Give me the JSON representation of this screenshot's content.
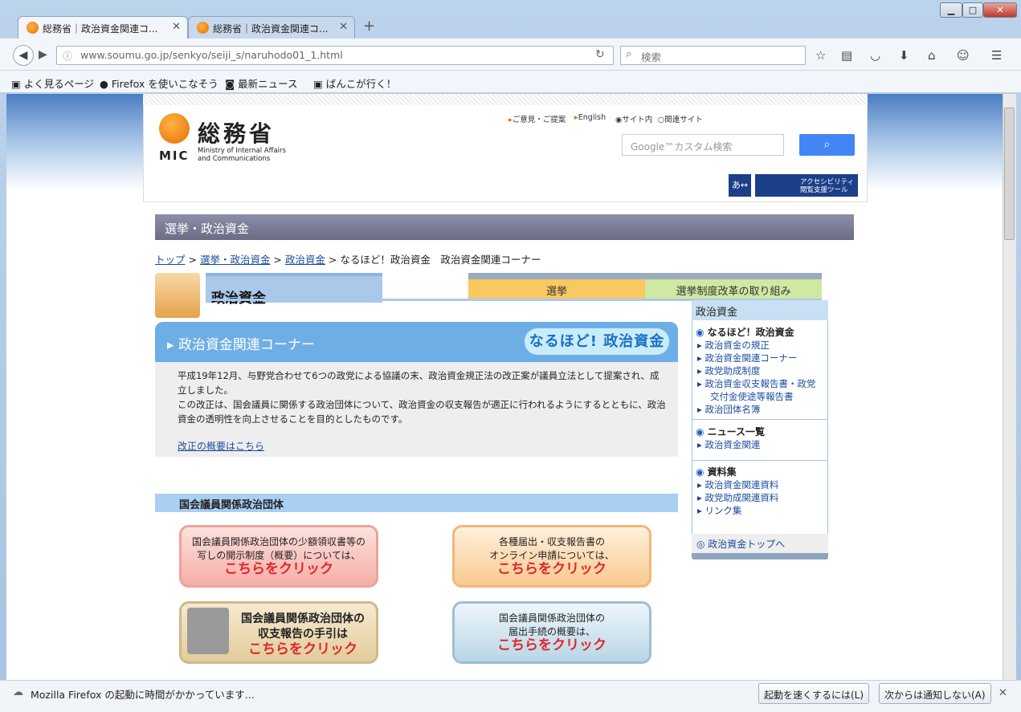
{
  "browser": {
    "tabs": [
      {
        "title": "総務省｜政治資金関連コ..."
      },
      {
        "title": "総務省｜政治資金関連コ..."
      }
    ],
    "url": "www.soumu.go.jp/senkyo/seiji_s/naruhodo01_1.html",
    "search_placeholder": "検索",
    "bookmarks": [
      "よく見るページ",
      "Firefox を使いこなそう",
      "最新ニュース",
      "ばんこが行く！"
    ],
    "status_message": "Mozilla Firefox の起動に時間がかかっています...",
    "status_buttons": [
      "起動を速くするには(L)",
      "次からは通知しない(A)"
    ]
  },
  "site": {
    "logo_text": "総務省",
    "logo_mic": "MIC",
    "logo_sub1": "Ministry of Internal Affairs",
    "logo_sub2": "and Communications",
    "links": [
      "ご意見・ご提案",
      "English"
    ],
    "radio": [
      "サイト内",
      "関連サイト"
    ],
    "search_placeholder": "Google™カスタム検索",
    "acc_label1": "アクセシビリティ",
    "acc_label2": "閲覧支援ツール",
    "acc_size": "あ↔あ",
    "section_title": "選挙・政治資金",
    "breadcrumb": [
      "トップ",
      "選挙・政治資金",
      "政治資金"
    ],
    "breadcrumb_current": "なるほど！政治資金　政治資金関連コーナー",
    "category_title": "政治資金",
    "tabs": [
      "選挙",
      "選挙制度改革の取り組み"
    ],
    "corner_title": "政治資金関連コーナー",
    "naruhodo": "なるほど! 政治資金",
    "body1": "平成19年12月、与野党合わせて6つの政党による協議の末、政治資金規正法の改正案が議員立法として提案され、成立しました。",
    "body2": "この改正は、国会議員に関係する政治団体について、政治資金の収支報告が適正に行われるようにするとともに、政治資金の透明性を向上させることを目的としたものです。",
    "kaisei_link": "改正の概要はこちら",
    "section_heading": "国会議員関係政治団体",
    "buttons": [
      {
        "line1": "国会議員関係政治団体の少額領収書等の",
        "line2": "写しの開示制度（概要）については、",
        "click": "こちらをクリック"
      },
      {
        "line1": "各種届出・収支報告書の",
        "line2": "オンライン申請については、",
        "click": "こちらをクリック"
      },
      {
        "line1": "国会議員関係政治団体の",
        "line2": "収支報告の手引は",
        "click": "こちらをクリック"
      },
      {
        "line1": "国会議員関係政治団体の",
        "line2": "届出手続の概要は、",
        "click": "こちらをクリック"
      }
    ],
    "sidebar": {
      "title": "政治資金",
      "group1_head": "なるほど！政治資金",
      "group1_items": [
        "政治資金の規正",
        "政治資金関連コーナー",
        "政党助成制度",
        "政治資金収支報告書・政党",
        "交付金使途等報告書",
        "政治団体名簿"
      ],
      "group2_head": "ニュース一覧",
      "group2_items": [
        "政治資金関連"
      ],
      "group3_head": "資料集",
      "group3_items": [
        "政治資金関連資料",
        "政党助成関連資料",
        "リンク集"
      ],
      "footer_link": "政治資金トップへ"
    }
  }
}
